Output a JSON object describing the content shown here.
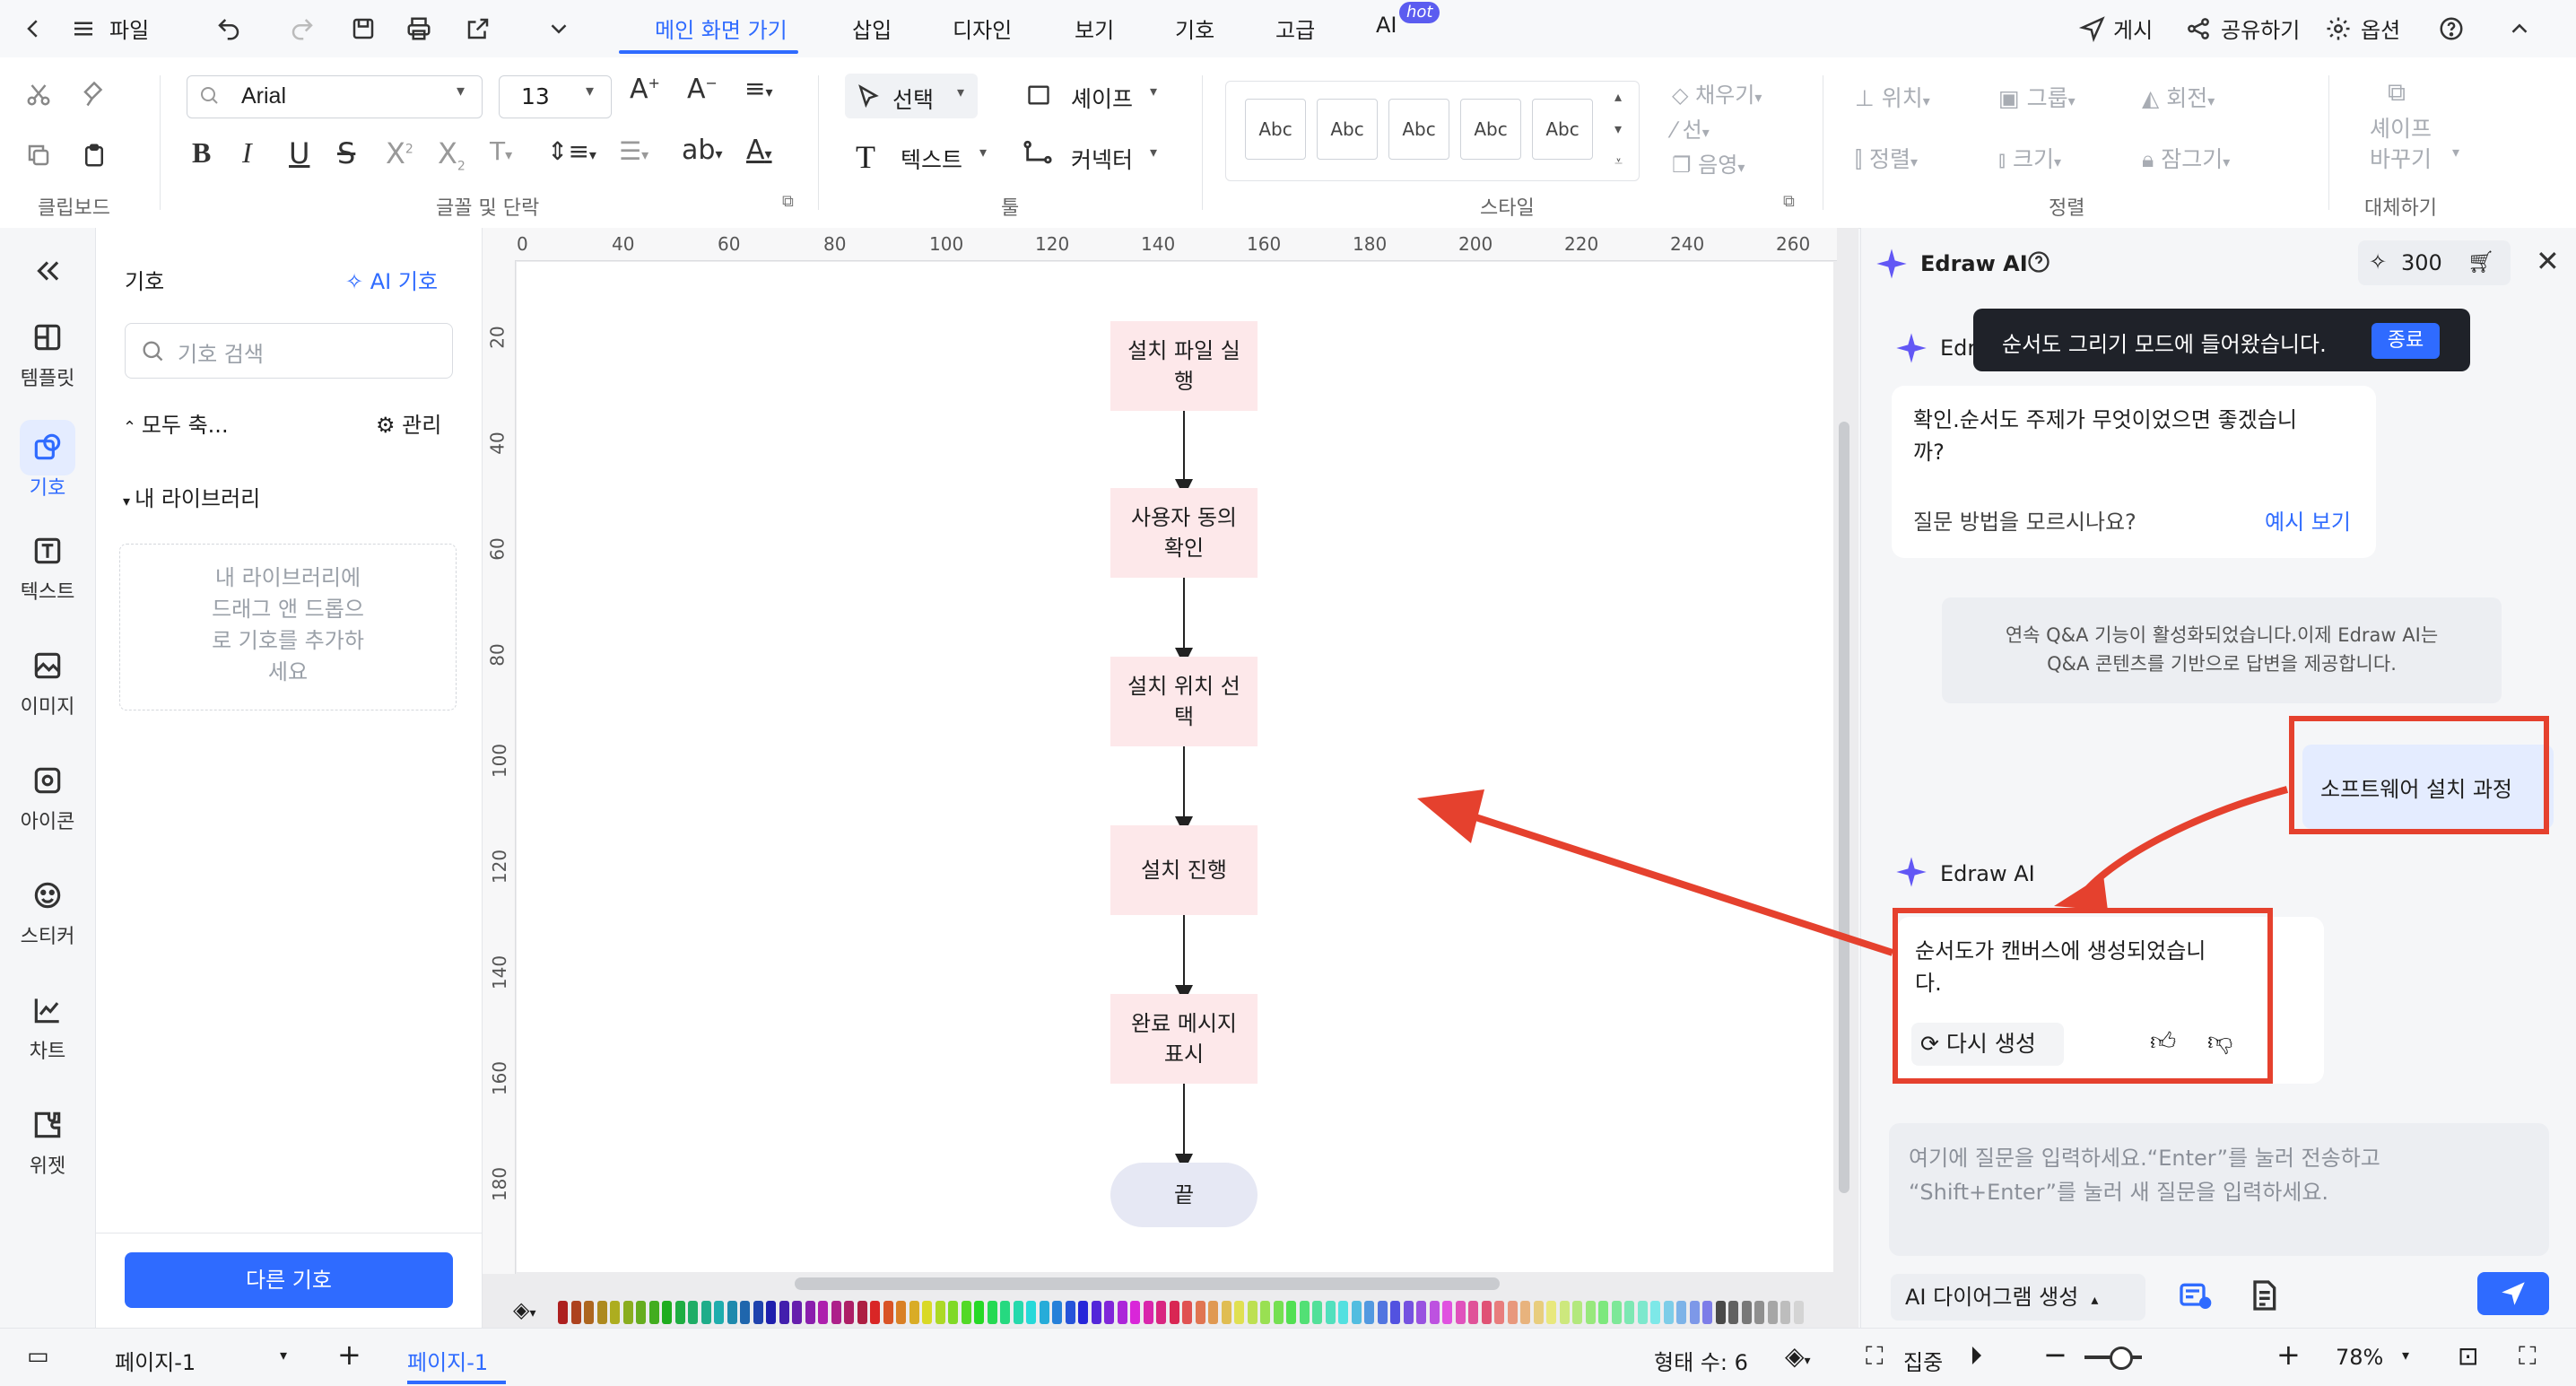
{
  "menubar": {
    "file_label": "파일",
    "tabs": [
      {
        "label": "메인 화면 가기"
      },
      {
        "label": "삽입"
      },
      {
        "label": "디자인"
      },
      {
        "label": "보기"
      },
      {
        "label": "기호"
      },
      {
        "label": "고급"
      },
      {
        "label": "AI"
      }
    ],
    "hot_badge": "hot",
    "publish": "게시",
    "share": "공유하기",
    "options": "옵션"
  },
  "ribbon": {
    "clipboard_label": "클립보드",
    "font_name": "Arial",
    "font_size": "13",
    "font_group_label": "글꼴 및 단락",
    "select_label": "선택",
    "shape_label": "셰이프",
    "text_label": "텍스트",
    "connector_label": "커넥터",
    "tools_label": "툴",
    "style_swatch": "Abc",
    "style_label": "스타일",
    "fill_label": "채우기",
    "line_label": "선",
    "shadow_label": "음영",
    "position_label": "위치",
    "group_label": "그룹",
    "rotate_label": "회전",
    "align_label": "정렬",
    "size_label": "크기",
    "lock_label": "잠그기",
    "arrange_label": "정렬",
    "replace_shape_label_1": "셰이프",
    "replace_shape_label_2": "바꾸기",
    "replace_label": "대체하기"
  },
  "leftbar": {
    "items": [
      {
        "label": "템플릿",
        "icon": "template-icon"
      },
      {
        "label": "기호",
        "icon": "symbol-icon"
      },
      {
        "label": "텍스트",
        "icon": "text-icon"
      },
      {
        "label": "이미지",
        "icon": "image-icon"
      },
      {
        "label": "아이콘",
        "icon": "icon-icon"
      },
      {
        "label": "스티커",
        "icon": "sticker-icon"
      },
      {
        "label": "차트",
        "icon": "chart-icon"
      },
      {
        "label": "위젯",
        "icon": "widget-icon"
      }
    ]
  },
  "symbols": {
    "title": "기호",
    "ai_symbol": "AI 기호",
    "search_placeholder": "기호 검색",
    "collapse_all": "모두 축...",
    "manage": "관리",
    "my_library": "내 라이브러리",
    "drop_hint_lines": [
      "내 라이브러리에",
      "드래그 앤 드롭으",
      "로 기호를 추가하",
      "세요"
    ],
    "more_symbols": "다른 기호"
  },
  "ruler": {
    "top": [
      "0",
      "40",
      "60",
      "80",
      "100",
      "120",
      "140",
      "160",
      "180",
      "200",
      "220",
      "240",
      "260"
    ],
    "left": [
      "20",
      "40",
      "60",
      "80",
      "100",
      "120",
      "140",
      "160",
      "180"
    ]
  },
  "flowchart": {
    "nodes": [
      {
        "label": "설치 파일 실행",
        "line1": "설치 파일 실",
        "line2": "행"
      },
      {
        "label": "사용자 동의 확인",
        "line1": "사용자 동의",
        "line2": "확인"
      },
      {
        "label": "설치 위치 선택",
        "line1": "설치 위치 선",
        "line2": "택"
      },
      {
        "label": "설치 진행",
        "line1": "설치 진행",
        "line2": ""
      },
      {
        "label": "완료 메시지 표시",
        "line1": "완료 메시지",
        "line2": "표시"
      },
      {
        "label": "끝",
        "line1": "끝",
        "line2": ""
      }
    ],
    "node_fill": "#fde8ea",
    "end_fill": "#e6e8f4"
  },
  "aipanel": {
    "title": "Edraw AI",
    "credits": "300",
    "sender": "Edraw AI",
    "tooltip_text": "순서도 그리기 모드에 들어왔습니다.",
    "tooltip_button": "종료",
    "bot_msg_line1": "확인.순서도 주제가 무엇이었으면 좋겠습니",
    "bot_msg_line2": "까?",
    "help_question": "질문 방법을 모르시나요?",
    "see_example": "예시 보기",
    "notice_line1": "연속 Q&A 기능이 활성화되었습니다.이제 Edraw AI는",
    "notice_line2": "Q&A 콘텐츠를 기반으로 답변을 제공합니다.",
    "user_msg": "소프트웨어 설치 과정",
    "result_line1": "순서도가 캔버스에 생성되었습니",
    "result_line2": "다.",
    "regenerate": "다시 생성",
    "input_placeholder_line1": "여기에 질문을 입력하세요.“Enter”를 눌러 전송하고",
    "input_placeholder_line2": "“Shift+Enter”를 눌러 새 질문을 입력하세요.",
    "mode_select": "AI 다이어그램 생성",
    "highlight_color": "#e5412e",
    "accent_color": "#2f6bff"
  },
  "statusbar": {
    "page_selector": "페이지-1",
    "page_tab": "페이지-1",
    "shape_count": "형태 수: 6",
    "focus": "집중",
    "zoom": "78%"
  }
}
